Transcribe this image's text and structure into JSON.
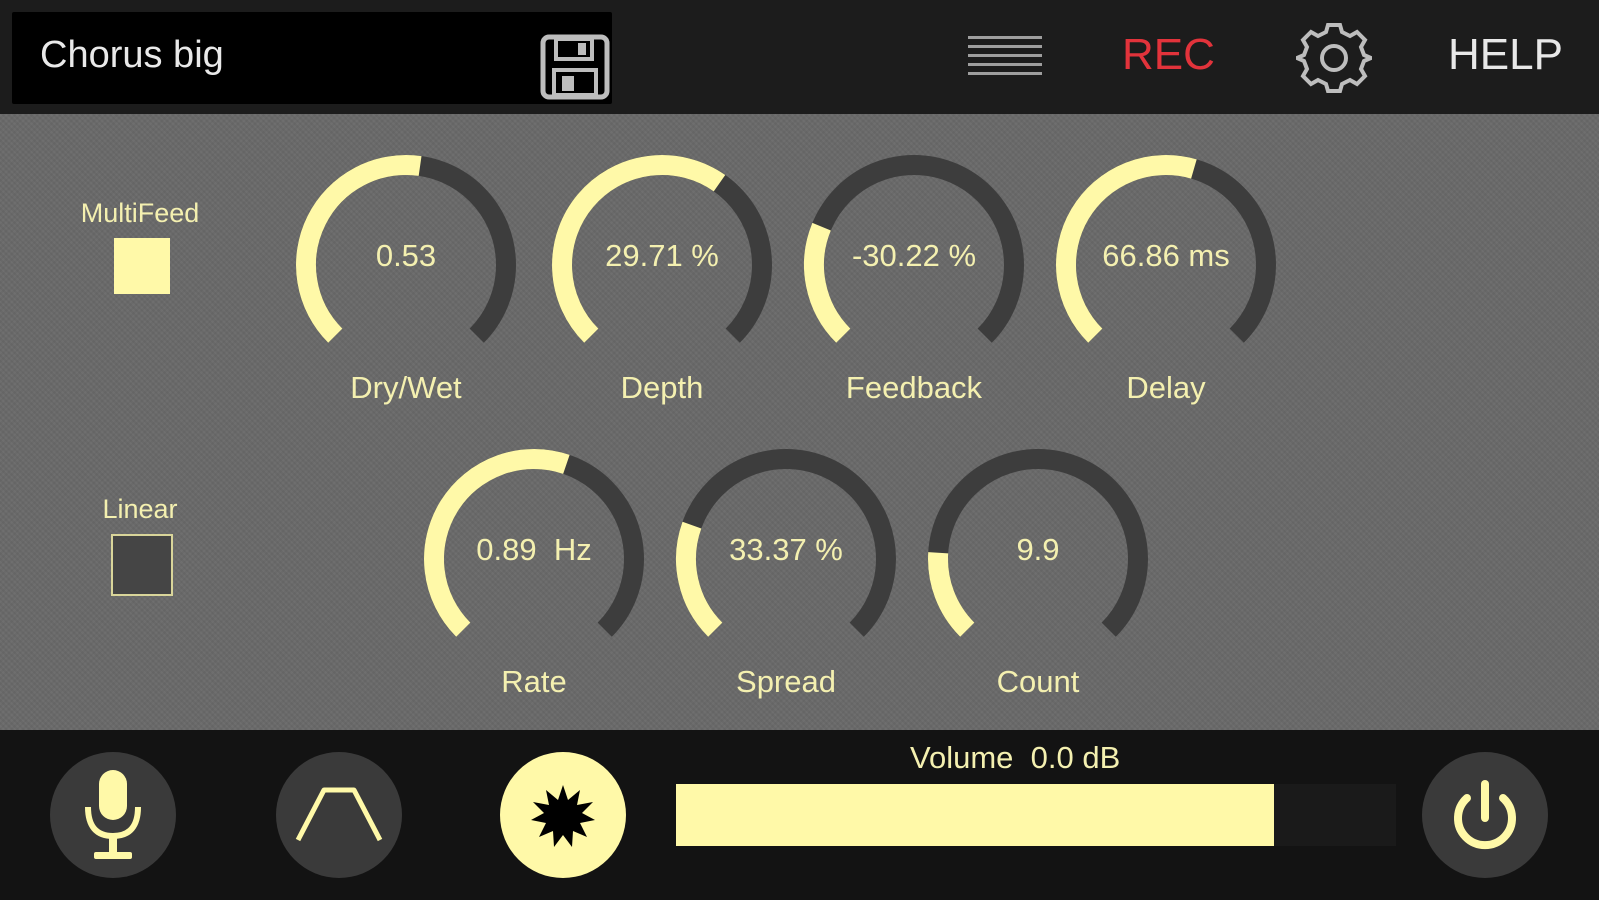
{
  "header": {
    "preset_name": "Chorus big",
    "rec_label": "REC",
    "help_label": "HELP"
  },
  "icons": {
    "save": "floppy-disk-icon",
    "menu": "hamburger-menu-icon",
    "settings": "gear-icon",
    "mic": "microphone-icon",
    "envelope": "envelope-shape-icon",
    "fx": "burst-icon",
    "power": "power-icon"
  },
  "toggles": [
    {
      "label": "MultiFeed",
      "checked": true
    },
    {
      "label": "Linear",
      "checked": false
    }
  ],
  "knobs": [
    {
      "label": "Dry/Wet",
      "value_text": "0.53",
      "fraction": 0.53
    },
    {
      "label": "Depth",
      "value_text": "29.71 %",
      "fraction": 0.63
    },
    {
      "label": "Feedback",
      "value_text": "-30.22 %",
      "fraction": 0.25
    },
    {
      "label": "Delay",
      "value_text": "66.86 ms",
      "fraction": 0.56
    },
    {
      "label": "Rate",
      "value_text": "0.89  Hz",
      "fraction": 0.57
    },
    {
      "label": "Spread",
      "value_text": "33.37 %",
      "fraction": 0.24
    },
    {
      "label": "Count",
      "value_text": "9.9",
      "fraction": 0.18
    }
  ],
  "volume": {
    "label": "Volume  0.0 dB",
    "fraction": 0.83
  },
  "colors": {
    "accent": "#fff9a8",
    "track": "#3d3d3d",
    "rec": "#e2333b",
    "panel": "#6a6a6a"
  }
}
